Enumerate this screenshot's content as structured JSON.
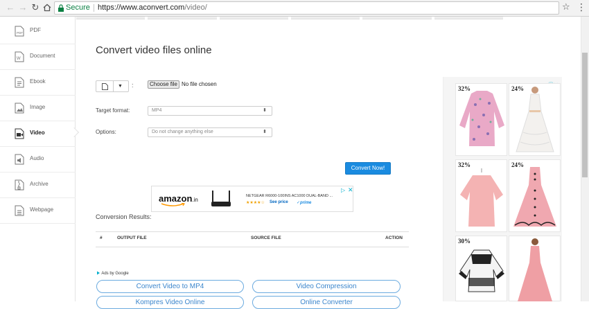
{
  "browser": {
    "secure_label": "Secure",
    "url_protocol": "https://",
    "url_host": "www.aconvert.com",
    "url_path": "/video/"
  },
  "sidebar": {
    "items": [
      {
        "label": "PDF",
        "icon": "pdf-icon"
      },
      {
        "label": "Document",
        "icon": "document-icon"
      },
      {
        "label": "Ebook",
        "icon": "ebook-icon"
      },
      {
        "label": "Image",
        "icon": "image-icon"
      },
      {
        "label": "Video",
        "icon": "video-icon",
        "active": true
      },
      {
        "label": "Audio",
        "icon": "audio-icon"
      },
      {
        "label": "Archive",
        "icon": "archive-icon"
      },
      {
        "label": "Webpage",
        "icon": "webpage-icon"
      }
    ]
  },
  "main": {
    "title": "Convert video files online",
    "file_colon": ":",
    "choose_file_label": "Choose file",
    "no_file_text": "No file chosen",
    "target_format_label": "Target format:",
    "target_format_value": "MP4",
    "options_label": "Options:",
    "options_value": "Do not change anything else",
    "convert_label": "Convert Now!",
    "results_label": "Conversion Results:",
    "columns": [
      "#",
      "OUTPUT FILE",
      "SOURCE FILE",
      "ACTION"
    ],
    "ads_by": "Ads by Google",
    "ad_links": [
      "Convert Video to MP4",
      "Video Compression",
      "Kompres Video Online",
      "Online Converter"
    ]
  },
  "amazon_ad": {
    "logo": "amazon",
    "tld": ".in",
    "product": "NETGEAR R6000-100INS AC1000 DUAL-BAND ...",
    "rating": "★★★★☆",
    "price_link": "See price",
    "prime": "✓prime"
  },
  "right_ad": {
    "products": [
      {
        "discount": "32%"
      },
      {
        "discount": "24%"
      },
      {
        "discount": "32%"
      },
      {
        "discount": "24%"
      },
      {
        "discount": "30%"
      },
      {
        "discount": ""
      }
    ]
  },
  "colors": {
    "accent": "#1a8be0",
    "pill_border": "#6aaadf",
    "secure_green": "#0b8043"
  }
}
